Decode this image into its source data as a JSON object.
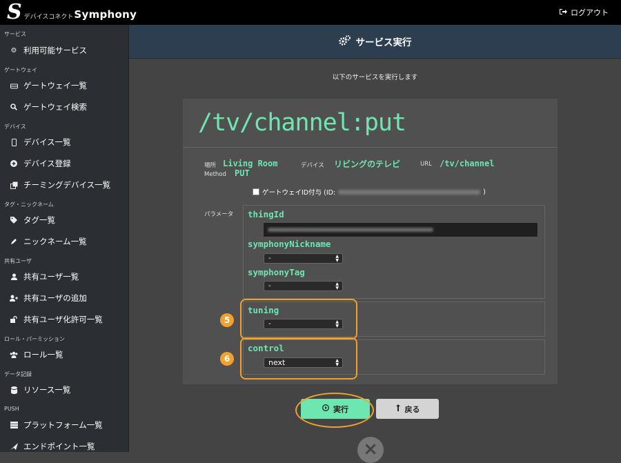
{
  "app": {
    "brand_small": "デバイスコネクト",
    "brand_big": "Symphony",
    "logout": "ログアウト"
  },
  "sidebar": {
    "sections": [
      {
        "label": "サービス"
      },
      {
        "label": "ゲートウェイ"
      },
      {
        "label": "デバイス"
      },
      {
        "label": "タグ・ニックネーム"
      },
      {
        "label": "共有ユーザ"
      },
      {
        "label": "ロール・パーミッション"
      },
      {
        "label": "データ記録"
      },
      {
        "label": "PUSH"
      }
    ],
    "items": [
      {
        "label": "利用可能サービス",
        "icon": "gears-icon"
      },
      {
        "label": "ゲートウェイ一覧",
        "icon": "hdd-icon"
      },
      {
        "label": "ゲートウェイ検索",
        "icon": "search-icon"
      },
      {
        "label": "デバイス一覧",
        "icon": "mobile-icon"
      },
      {
        "label": "デバイス登録",
        "icon": "plus-circle-icon"
      },
      {
        "label": "チーミングデバイス一覧",
        "icon": "clone-icon"
      },
      {
        "label": "タグ一覧",
        "icon": "tags-icon"
      },
      {
        "label": "ニックネーム一覧",
        "icon": "pencil-icon"
      },
      {
        "label": "共有ユーザ一覧",
        "icon": "user-icon"
      },
      {
        "label": "共有ユーザの追加",
        "icon": "user-plus-icon"
      },
      {
        "label": "共有ユーザ化許可一覧",
        "icon": "unlock-icon"
      },
      {
        "label": "ロール一覧",
        "icon": "users-icon"
      },
      {
        "label": "リソース一覧",
        "icon": "database-icon"
      },
      {
        "label": "プラットフォーム一覧",
        "icon": "server-icon"
      },
      {
        "label": "エンドポイント一覧",
        "icon": "paper-plane-icon"
      }
    ]
  },
  "header": {
    "title": "サービス実行"
  },
  "main": {
    "subtitle": "以下のサービスを実行します",
    "endpoint": "/tv/channel:put",
    "meta": {
      "place_label": "場所",
      "place_value": "Living Room",
      "device_label": "デバイス",
      "device_value": "リビングのテレビ",
      "url_label": "URL",
      "url_value": "/tv/channel",
      "method_label": "Method",
      "method_value": "PUT"
    },
    "gateway_checkbox_label": "ゲートウェイID付与 (ID:",
    "gateway_checkbox_suffix": ")",
    "params_label": "パラメータ",
    "params": {
      "thingId": "thingId",
      "symphonyNickname": "symphonyNickname",
      "nickname_value": "-",
      "symphonyTag": "symphonyTag",
      "tag_value": "-",
      "tuning": "tuning",
      "tuning_value": "-",
      "control": "control",
      "control_value": "next"
    },
    "badges": {
      "tuning": "5",
      "control": "6"
    },
    "execute_button": "実行",
    "back_button": "戻る"
  },
  "colors": {
    "accent": "#6ee6b0",
    "highlight": "#f2a12e",
    "header": "#2c3e50",
    "sidebar": "#2b2f33"
  }
}
